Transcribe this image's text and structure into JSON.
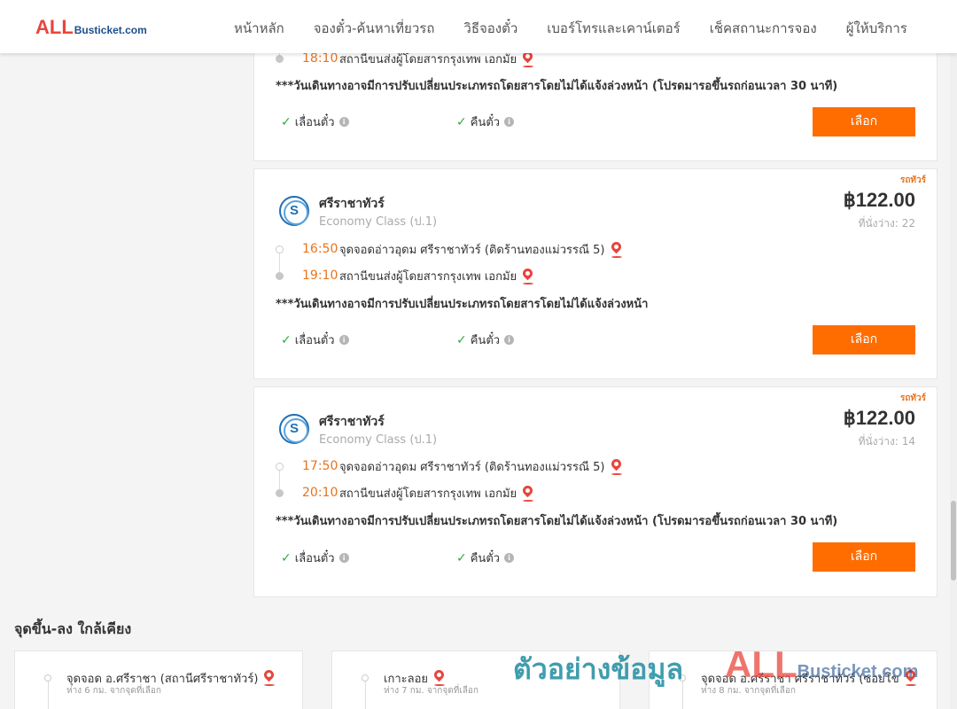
{
  "header": {
    "logo_main": "ALL",
    "logo_rest": "Busticket.com",
    "nav": [
      "หน้าหลัก",
      "จองตั๋ว-ค้นหาเที่ยวรถ",
      "วิธีจองตั๋ว",
      "เบอร์โทรและเคาน์เตอร์",
      "เช็คสถานะการจอง",
      "ผู้ให้บริการ"
    ]
  },
  "trips": [
    {
      "arrive_time": "18:10",
      "arrive_place": "สถานีขนส่งผู้โดยสารกรุงเทพ เอกมัย",
      "note": "***วันเดินทางอาจมีการปรับเปลี่ยนประเภทรถโดยสารโดยไม่ได้แจ้งล่วงหน้า (โปรดมารอขึ้นรถก่อนเวลา 30 นาที)",
      "feature_change": "เลื่อนตั๋ว",
      "feature_refund": "คืนตั๋ว",
      "select_label": "เลือก"
    },
    {
      "tag": "รถทัวร์",
      "operator": "ศรีราชาทัวร์",
      "class": "Economy Class (ป.1)",
      "price": "฿122.00",
      "seats": "ที่นั่งว่าง: 22",
      "depart_time": "16:50",
      "depart_place": "จุดจอดอ่าวอุดม ศรีราชาทัวร์ (ติดร้านทองแม่วรรณี 5)",
      "arrive_time": "19:10",
      "arrive_place": "สถานีขนส่งผู้โดยสารกรุงเทพ เอกมัย",
      "note": "***วันเดินทางอาจมีการปรับเปลี่ยนประเภทรถโดยสารโดยไม่ได้แจ้งล่วงหน้า",
      "feature_change": "เลื่อนตั๋ว",
      "feature_refund": "คืนตั๋ว",
      "select_label": "เลือก"
    },
    {
      "tag": "รถทัวร์",
      "operator": "ศรีราชาทัวร์",
      "class": "Economy Class (ป.1)",
      "price": "฿122.00",
      "seats": "ที่นั่งว่าง: 14",
      "depart_time": "17:50",
      "depart_place": "จุดจอดอ่าวอุดม ศรีราชาทัวร์ (ติดร้านทองแม่วรรณี 5)",
      "arrive_time": "20:10",
      "arrive_place": "สถานีขนส่งผู้โดยสารกรุงเทพ เอกมัย",
      "note": "***วันเดินทางอาจมีการปรับเปลี่ยนประเภทรถโดยสารโดยไม่ได้แจ้งล่วงหน้า (โปรดมารอขึ้นรถก่อนเวลา 30 นาที)",
      "feature_change": "เลื่อนตั๋ว",
      "feature_refund": "คืนตั๋ว",
      "select_label": "เลือก"
    }
  ],
  "nearby": {
    "title": "จุดขึ้น-ลง ใกล้เคียง",
    "items": [
      {
        "name": "จุดจอด อ.ศรีราชา (สถานีศรีราชาทัวร์)",
        "distance": "ห่าง 6 กม. จากจุดที่เลือก"
      },
      {
        "name": "เกาะลอย",
        "distance": "ห่าง 7 กม. จากจุดที่เลือก"
      },
      {
        "name": "จุดจอด อ.ศรีราชา ศรีราชาทัวร์ (ซอยโข",
        "distance": "ห่าง 8 กม. จากจุดที่เลือก"
      }
    ]
  },
  "watermark": {
    "text": "ตัวอย่างข้อมูล",
    "logo_main": "ALL",
    "logo_rest": "Busticket.com"
  },
  "colors": {
    "accent_orange": "#ff6d00",
    "time_orange": "#e8731c",
    "pin_red": "#e8453c",
    "check_green": "#2eab3f"
  }
}
